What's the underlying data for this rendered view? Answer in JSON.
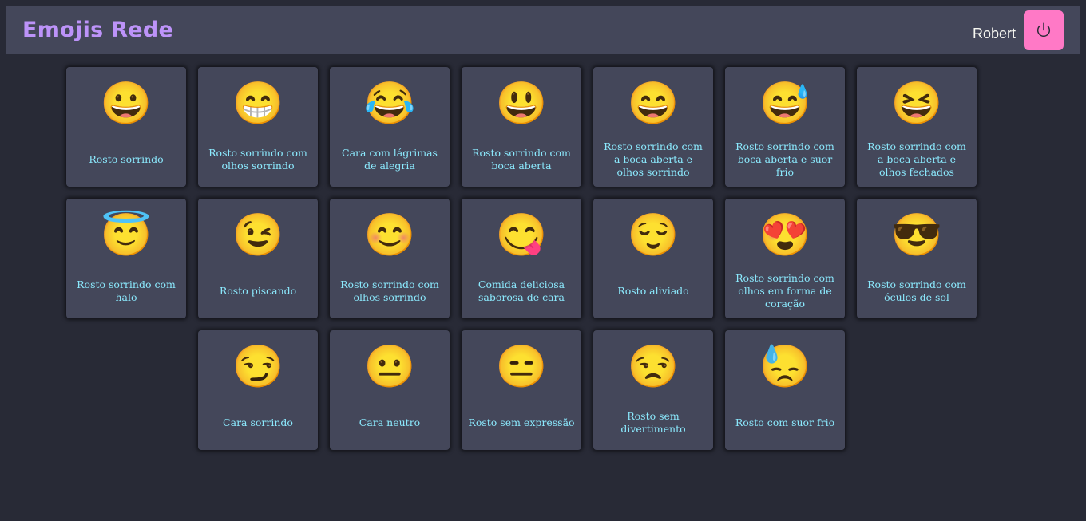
{
  "header": {
    "title": "Emojis Rede",
    "user_name": "Robert",
    "logout_icon": "power-icon"
  },
  "emojis": [
    {
      "char": "😀",
      "label": "Rosto sorrindo"
    },
    {
      "char": "😁",
      "label": "Rosto sorrindo com olhos sorrindo"
    },
    {
      "char": "😂",
      "label": "Cara com lágrimas de alegria"
    },
    {
      "char": "😃",
      "label": "Rosto sorrindo com boca aberta"
    },
    {
      "char": "😄",
      "label": "Rosto sorrindo com a boca aberta e olhos sorrindo"
    },
    {
      "char": "😅",
      "label": "Rosto sorrindo com boca aberta e suor frio"
    },
    {
      "char": "😆",
      "label": "Rosto sorrindo com a boca aberta e olhos fechados"
    },
    {
      "char": "😇",
      "label": "Rosto sorrindo com halo"
    },
    {
      "char": "😉",
      "label": "Rosto piscando"
    },
    {
      "char": "😊",
      "label": "Rosto sorrindo com olhos sorrindo"
    },
    {
      "char": "😋",
      "label": "Comida deliciosa saborosa de cara"
    },
    {
      "char": "😌",
      "label": "Rosto aliviado"
    },
    {
      "char": "😍",
      "label": "Rosto sorrindo com olhos em forma de coração"
    },
    {
      "char": "😎",
      "label": "Rosto sorrindo com óculos de sol"
    },
    {
      "char": "😏",
      "label": "Cara sorrindo"
    },
    {
      "char": "😐",
      "label": "Cara neutro"
    },
    {
      "char": "😑",
      "label": "Rosto sem expressão"
    },
    {
      "char": "😒",
      "label": "Rosto sem divertimento"
    },
    {
      "char": "😓",
      "label": "Rosto com suor frio"
    }
  ],
  "colors": {
    "background": "#282a36",
    "header": "#44475a",
    "card": "#44475a",
    "title": "#bd93f9",
    "label": "#8be9fd",
    "logout_button": "#ff79c6",
    "user_name": "#f8f8f2"
  }
}
